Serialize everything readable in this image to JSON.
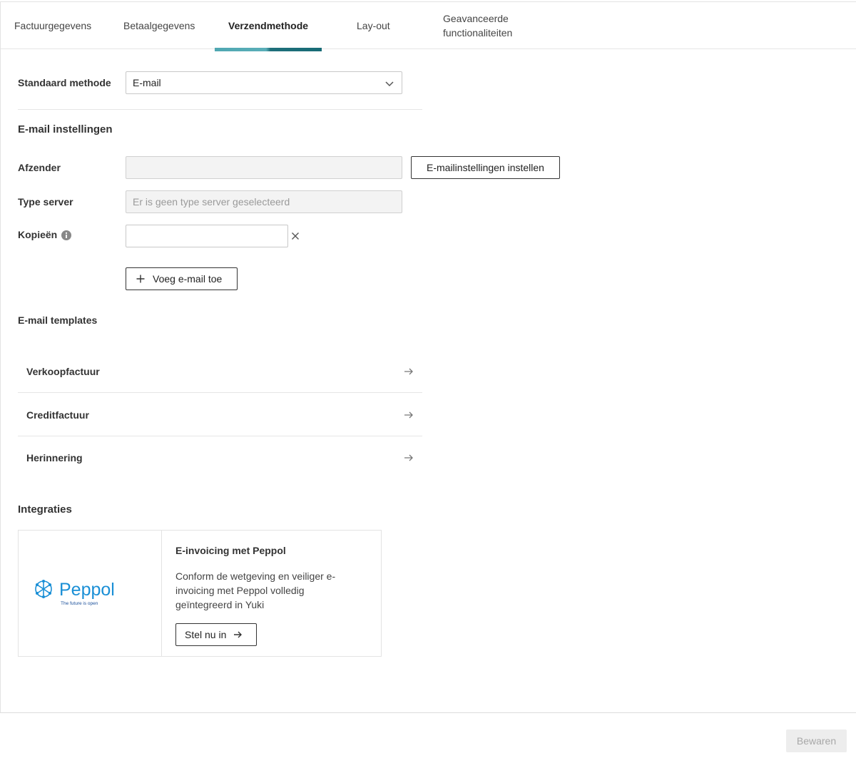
{
  "tabs": [
    {
      "label": "Factuurgegevens"
    },
    {
      "label": "Betaalgegevens"
    },
    {
      "label": "Verzendmethode"
    },
    {
      "label": "Lay-out"
    },
    {
      "label_line1": "Geavanceerde",
      "label_line2": "functionaliteiten"
    }
  ],
  "active_tab": "Verzendmethode",
  "standard_method": {
    "label": "Standaard methode",
    "value": "E-mail"
  },
  "email_settings": {
    "heading": "E-mail instellingen",
    "sender": {
      "label": "Afzender",
      "value": ""
    },
    "configure_button": "E-mailinstellingen instellen",
    "server_type": {
      "label": "Type server",
      "placeholder": "Er is geen type server geselecteerd"
    },
    "copies": {
      "label": "Kopieën",
      "value": ""
    },
    "add_email_button": "Voeg e-mail toe"
  },
  "templates": {
    "heading": "E-mail templates",
    "items": [
      {
        "label": "Verkoopfactuur"
      },
      {
        "label": "Creditfactuur"
      },
      {
        "label": "Herinnering"
      }
    ]
  },
  "integrations": {
    "heading": "Integraties",
    "card": {
      "logo_text": "Peppol",
      "logo_tagline": "The future is open",
      "title": "E-invoicing met Peppol",
      "description": "Conform de wetgeving en veiliger e-invoicing met Peppol volledig geïntegreerd in Yuki",
      "button": "Stel nu in"
    }
  },
  "footer": {
    "save_button": "Bewaren"
  },
  "colors": {
    "accent": "#1f6f7a",
    "accent_light": "#5aaeb8",
    "peppol_blue": "#1a8fd6"
  },
  "icons": [
    "chevron-down-icon",
    "info-icon",
    "close-icon",
    "plus-icon",
    "arrow-right-icon",
    "peppol-logo"
  ]
}
